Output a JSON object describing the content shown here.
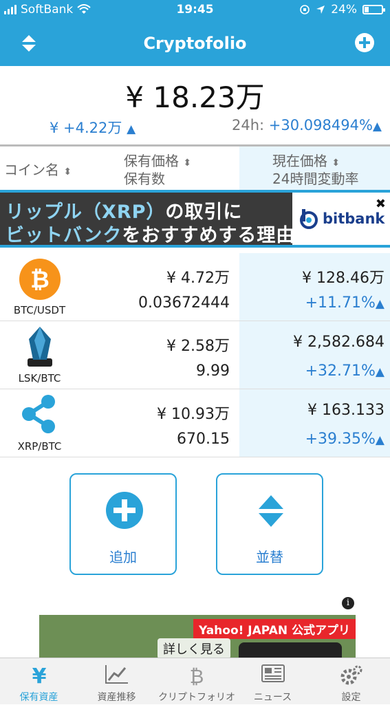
{
  "status_bar": {
    "carrier": "SoftBank",
    "time": "19:45",
    "battery": "24%",
    "battery_level": 0.24
  },
  "nav": {
    "title": "Cryptofolio"
  },
  "summary": {
    "total": "¥ 18.23万",
    "change": "¥ +4.22万",
    "period_label": "24h:",
    "period_change": "+30.098494%"
  },
  "columns": {
    "coin": "コイン名",
    "holding_line1": "保有価格",
    "holding_line2": "保有数",
    "current_line1": "現在価格",
    "current_line2": "24時間変動率"
  },
  "banner": {
    "line1_a": "リップル（XRP）",
    "line1_b": "の取引に",
    "line2_a": "ビットバンク",
    "line2_b": "をおすすめする理由",
    "brand": "bitbank"
  },
  "holdings": [
    {
      "pair": "BTC/USDT",
      "holding_value": "¥ 4.72万",
      "quantity": "0.03672444",
      "price": "¥ 128.46万",
      "change": "+11.71%",
      "icon": "bitcoin-icon",
      "color": "#f7931a"
    },
    {
      "pair": "LSK/BTC",
      "holding_value": "¥ 2.58万",
      "quantity": "9.99",
      "price": "¥ 2,582.684",
      "change": "+32.71%",
      "icon": "lisk-icon",
      "color": "#1a6896"
    },
    {
      "pair": "XRP/BTC",
      "holding_value": "¥ 10.93万",
      "quantity": "670.15",
      "price": "¥ 163.133",
      "change": "+39.35%",
      "icon": "ripple-icon",
      "color": "#2aa3d9"
    }
  ],
  "actions": {
    "add": "追加",
    "sort": "並替"
  },
  "ad": {
    "badge": "Yahoo! JAPAN 公式アプリ",
    "more": "詳しく見る",
    "info": "i"
  },
  "tabs": [
    {
      "label": "保有資産",
      "icon": "yen-icon",
      "active": true
    },
    {
      "label": "資産推移",
      "icon": "chart-icon",
      "active": false
    },
    {
      "label": "クリプトフォリオ",
      "icon": "bitcoin-logo-icon",
      "active": false
    },
    {
      "label": "ニュース",
      "icon": "newspaper-icon",
      "active": false
    },
    {
      "label": "設定",
      "icon": "gear-icon",
      "active": false
    }
  ],
  "colors": {
    "accent": "#2aa3d9",
    "positive": "#2b7fd0",
    "highlight_bg": "#e8f6fd"
  }
}
